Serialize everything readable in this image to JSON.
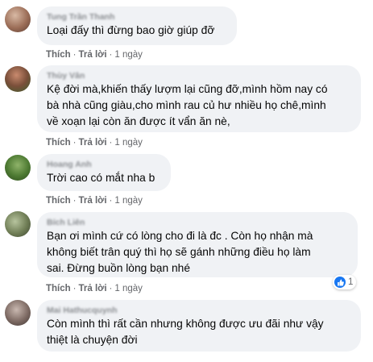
{
  "actions": {
    "like": "Thích",
    "reply": "Trả lời",
    "separator": "·"
  },
  "comments": [
    {
      "author": "Tung Trần Thanh",
      "text": "Loại đấy thì đừng bao giờ giúp đỡ",
      "time": "1 ngày"
    },
    {
      "author": "Thùy Vân",
      "text": "Kệ đời mà,khiến thấy lượm lại cũng đỡ,mình hồm nay có\nbà nhà cũng giàu,cho mình rau củ hư nhiều họ chê,mình\nvề xoạn lại còn ăn được ít vẩn ăn nè,",
      "time": "1 ngày"
    },
    {
      "author": "Hoang Anh",
      "text": "Trời cao có mắt nha b",
      "time": "1 ngày"
    },
    {
      "author": "Bích Liên",
      "text": "Bạn ơi mình cứ có lòng cho đi là đc . Còn họ nhận mà\nkhông biết trân quý thì họ sẽ gánh những điều họ làm\nsai. Đừng buồn lòng bạn nhé",
      "time": "1 ngày",
      "reaction_count": "1"
    },
    {
      "author": "Mai Hathucquynh",
      "text": "Còn mình thì rất cần nhưng không được ưu đãi như vậy\nthiệt là chuyện đời",
      "time": ""
    }
  ],
  "colors": {
    "bubble": "#f0f2f5",
    "like_blue": "#1877f2",
    "meta": "#65676b"
  }
}
